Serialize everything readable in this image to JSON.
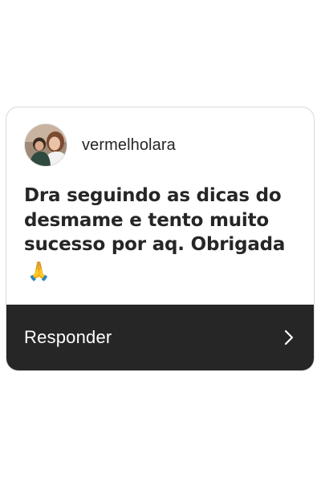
{
  "message_card": {
    "username": "vermelholara",
    "message": "Dra seguindo as dicas do desmame e tento muito sucesso por aq. Obrigada",
    "emoji": "🙏",
    "reply_label": "Responder",
    "reply_icon": "chevron-right-icon",
    "avatar_icon": "user-avatar",
    "colors": {
      "reply_bar": "#262626",
      "text": "#262626",
      "card_border": "#d9d9d9"
    }
  }
}
